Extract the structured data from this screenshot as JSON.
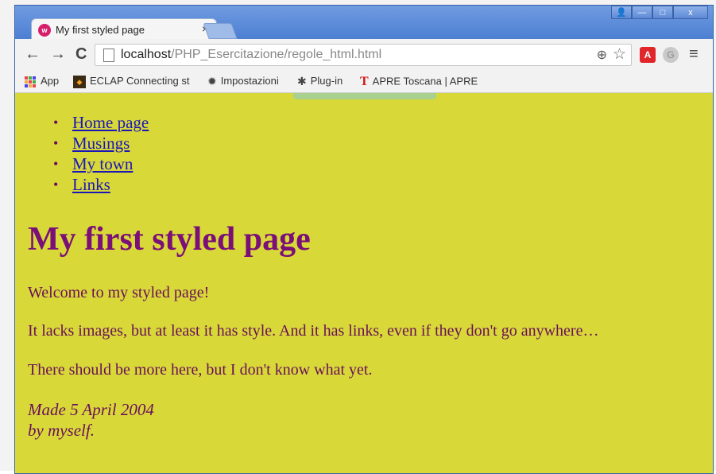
{
  "browser": {
    "tab": {
      "title": "My first styled page",
      "favicon_text": "w",
      "close": "×"
    },
    "window_controls": {
      "user": "👤",
      "minimize": "—",
      "maximize": "□",
      "close": "x"
    },
    "nav": {
      "back": "←",
      "forward": "→",
      "reload": "C"
    },
    "address": {
      "host": "localhost",
      "path": "/PHP_Esercitazione/regole_html.html"
    },
    "extensions": {
      "acrobat": "A",
      "other": "G",
      "menu": "≡"
    },
    "bookmarks": [
      {
        "label": "App",
        "icon": "apps-grid-icon"
      },
      {
        "label": "ECLAP Connecting st",
        "icon": "eclap-icon"
      },
      {
        "label": "Impostazioni",
        "icon": "gear-icon"
      },
      {
        "label": "Plug-in",
        "icon": "puzzle-icon"
      },
      {
        "label": "APRE Toscana | APRE",
        "icon": "apre-icon"
      }
    ],
    "colors": {
      "content_bg": "#d8d938",
      "link": "#1b16b8",
      "text": "#6b0f5a",
      "heading": "#7b0f78"
    }
  },
  "page": {
    "nav_links": [
      "Home page",
      "Musings",
      "My town",
      "Links"
    ],
    "heading": "My first styled page",
    "paragraphs": [
      "Welcome to my styled page!",
      "It lacks images, but at least it has style. And it has links, even if they don't go anywhere…",
      "There should be more here, but I don't know what yet."
    ],
    "address_lines": [
      "Made 5 April 2004",
      "by myself."
    ]
  }
}
